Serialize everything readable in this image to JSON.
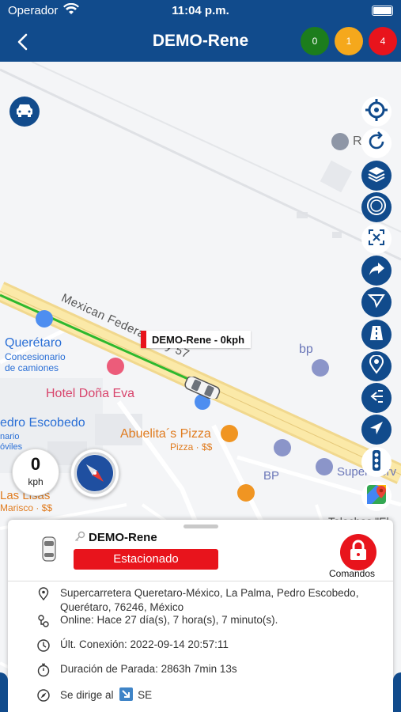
{
  "status_bar": {
    "carrier": "Operador",
    "time": "11:04 p.m."
  },
  "nav": {
    "title": "DEMO-Rene",
    "badges": [
      {
        "value": "0",
        "color": "#1c7d1c"
      },
      {
        "value": "1",
        "color": "#f5a81c"
      },
      {
        "value": "4",
        "color": "#e8141c"
      }
    ]
  },
  "map": {
    "labels": {
      "highway": "Mexican Federal Hwy 57",
      "queretaro": "Querétaro",
      "concesionario": "Concesionario",
      "concesionario2": "de camiones",
      "hotel": "Hotel Doña Eva",
      "pedro": "edro Escobedo",
      "pedro_sub1": "nario",
      "pedro_sub2": "óviles",
      "abuelita": "Abuelita´s Pizza",
      "abuelita_sub": "Pizza · $$",
      "bp_top": "bp",
      "bp_bottom": "BP",
      "super": "Super Serv",
      "talachas": "Talachas \"El",
      "rancho": "R",
      "lisas": "Las Lisas",
      "marisco": "Marisco · $$"
    },
    "vehicle_label": "DEMO-Rene - 0kph"
  },
  "speed": {
    "value": "0",
    "unit": "kph"
  },
  "sheet": {
    "name": "DEMO-Rene",
    "status": "Estacionado",
    "commands_label": "Comandos",
    "rows": [
      {
        "icon": "location-pin-icon",
        "text": "Supercarretera Queretaro-México, La Palma, Pedro Escobedo,",
        "text2": "Querétaro, 76246, México"
      },
      {
        "icon": "online-icon",
        "text": "Online: Hace 27 día(s), 7 hora(s), 7 minuto(s)."
      },
      {
        "icon": "clock-icon",
        "text": "Últ. Conexión: 2022-09-14 20:57:11"
      },
      {
        "icon": "stopwatch-icon",
        "text": "Duración de Parada: 2863h 7min 13s"
      },
      {
        "icon": "compass-icon",
        "text": "Se dirige al",
        "direction": "SE"
      }
    ]
  }
}
